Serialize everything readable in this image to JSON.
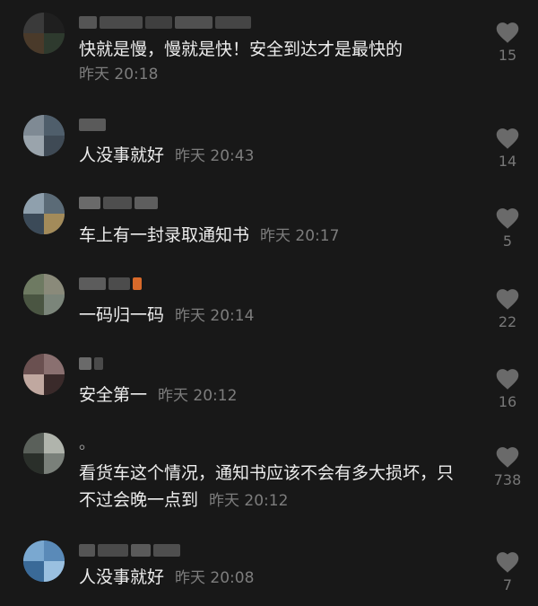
{
  "comments": [
    {
      "text": "快就是慢，慢就是快！安全到达才是最快的",
      "time": "昨天 20:18",
      "likes": "15"
    },
    {
      "text": "人没事就好",
      "time": "昨天 20:43",
      "likes": "14"
    },
    {
      "text": "车上有一封录取通知书",
      "time": "昨天 20:17",
      "likes": "5"
    },
    {
      "text": "一码归一码",
      "time": "昨天 20:14",
      "likes": "22"
    },
    {
      "text": "安全第一",
      "time": "昨天 20:12",
      "likes": "16"
    },
    {
      "text": "看货车这个情况，通知书应该不会有多大损坏，只不过会晚一点到",
      "time": "昨天 20:12",
      "likes": "738",
      "username_suffix": "。"
    },
    {
      "text": "人没事就好",
      "time": "昨天 20:08",
      "likes": "7"
    }
  ],
  "icons": {
    "like": "heart-icon"
  },
  "colors": {
    "background": "#181818",
    "text": "#ededed",
    "muted": "#7d7d7d"
  }
}
